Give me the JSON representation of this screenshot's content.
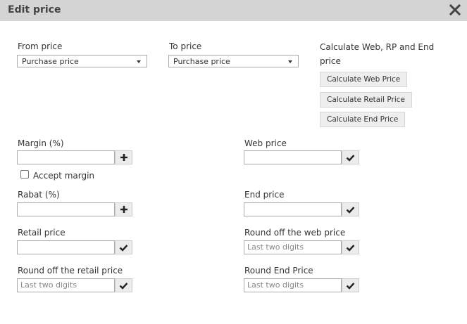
{
  "dialog": {
    "title": "Edit price"
  },
  "from_price": {
    "label": "From price",
    "value": "Purchase price"
  },
  "to_price": {
    "label": "To price",
    "value": "Purchase price"
  },
  "calculate": {
    "label": "Calculate Web, RP and End price",
    "buttons": [
      "Calculate Web Price",
      "Calculate Retail Price",
      "Calculate End Price"
    ]
  },
  "margin": {
    "label": "Margin (%)",
    "value": "",
    "accept_label": "Accept margin"
  },
  "rabat": {
    "label": "Rabat (%)",
    "value": ""
  },
  "retail_price": {
    "label": "Retail price",
    "value": ""
  },
  "round_retail": {
    "label": "Round off the retail price",
    "placeholder": "Last two digits"
  },
  "web_price": {
    "label": "Web price",
    "value": ""
  },
  "end_price": {
    "label": "End price",
    "value": ""
  },
  "round_web": {
    "label": "Round off the web price",
    "placeholder": "Last two digits"
  },
  "round_end": {
    "label": "Round End Price",
    "placeholder": "Last two digits"
  }
}
